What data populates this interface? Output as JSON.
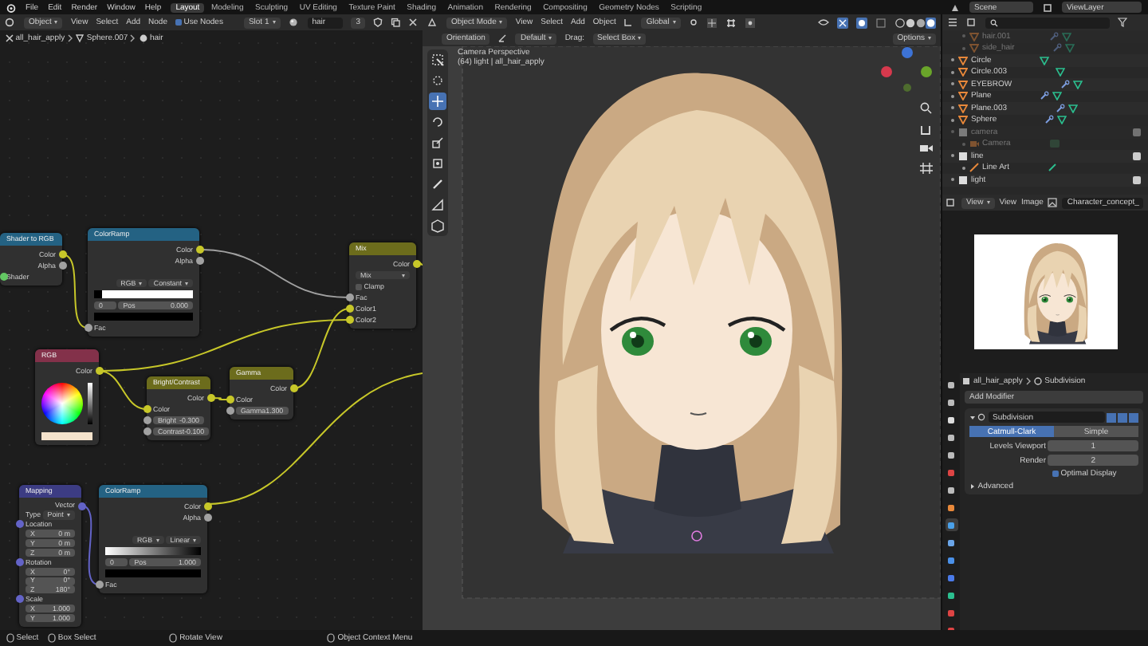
{
  "top_bar": {
    "menus": [
      "File",
      "Edit",
      "Render",
      "Window",
      "Help"
    ],
    "workspaces": [
      {
        "label": "Layout",
        "selected": true
      },
      {
        "label": "Modeling",
        "selected": false
      },
      {
        "label": "Sculpting",
        "selected": false
      },
      {
        "label": "UV Editing",
        "selected": false
      },
      {
        "label": "Texture Paint",
        "selected": false
      },
      {
        "label": "Shading",
        "selected": false
      },
      {
        "label": "Animation",
        "selected": false
      },
      {
        "label": "Rendering",
        "selected": false
      },
      {
        "label": "Compositing",
        "selected": false
      },
      {
        "label": "Geometry Nodes",
        "selected": false
      },
      {
        "label": "Scripting",
        "selected": false
      }
    ],
    "scene": "Scene",
    "view_layer": "ViewLayer"
  },
  "node_editor": {
    "header": {
      "mode": "Object",
      "menus": [
        "View",
        "Select",
        "Add",
        "Node"
      ],
      "use_nodes": {
        "label": "Use Nodes",
        "checked": true
      },
      "slot": "Slot 1",
      "material": "hair",
      "users": "3"
    },
    "breadcrumb": [
      "all_hair_apply",
      "Sphere.007",
      "hair"
    ],
    "nodes": [
      {
        "title": "Shader to RGB",
        "color": "#246283",
        "rows": [
          {
            "kind": "output",
            "label": "Color",
            "color": "#c7c729"
          },
          {
            "kind": "output",
            "label": "Alpha",
            "color": "#a1a1a1"
          },
          {
            "kind": "input",
            "label": "Shader",
            "color": "#63c763"
          }
        ]
      },
      {
        "title": "ColorRamp",
        "color": "#246283",
        "rows": [
          {
            "kind": "output",
            "label": "Color",
            "color": "#c7c729"
          },
          {
            "kind": "output",
            "label": "Alpha",
            "color": "#a1a1a1"
          },
          {
            "kind": "spacer"
          },
          {
            "kind": "select",
            "items": [
              "RGB",
              "Constant"
            ]
          },
          {
            "kind": "step_ramp"
          },
          {
            "kind": "stop",
            "index": "0",
            "label": "Pos",
            "value": "0.000"
          },
          {
            "kind": "swatch",
            "color": "#000000"
          },
          {
            "kind": "input",
            "label": "Fac",
            "color": "#a1a1a1"
          }
        ]
      },
      {
        "title": "Mix",
        "color": "#6c6c1c",
        "rows": [
          {
            "kind": "output",
            "label": "Color",
            "color": "#c7c729"
          },
          {
            "kind": "dropdown",
            "value": "Mix"
          },
          {
            "kind": "checkbox",
            "label": "Clamp",
            "checked": false
          },
          {
            "kind": "input",
            "label": "Fac",
            "color": "#a1a1a1"
          },
          {
            "kind": "input",
            "label": "Color1",
            "color": "#c7c729"
          },
          {
            "kind": "input",
            "label": "Color2",
            "color": "#c7c729"
          }
        ]
      },
      {
        "title": "RGB",
        "color": "#83314a",
        "rows": [
          {
            "kind": "output",
            "label": "Color",
            "color": "#c7c729"
          },
          {
            "kind": "wheel"
          },
          {
            "kind": "swatch",
            "color": "#f5e3cc"
          }
        ]
      },
      {
        "title": "Bright/Contrast",
        "color": "#6c6c1c",
        "rows": [
          {
            "kind": "output",
            "label": "Color",
            "color": "#c7c729"
          },
          {
            "kind": "input",
            "label": "Color",
            "color": "#c7c729"
          },
          {
            "kind": "field",
            "label": "Bright",
            "value": "-0.300",
            "color": "#a1a1a1"
          },
          {
            "kind": "field",
            "label": "Contrast",
            "value": "-0.100",
            "color": "#a1a1a1"
          }
        ]
      },
      {
        "title": "Gamma",
        "color": "#6c6c1c",
        "rows": [
          {
            "kind": "output",
            "label": "Color",
            "color": "#c7c729"
          },
          {
            "kind": "input",
            "label": "Color",
            "color": "#c7c729"
          },
          {
            "kind": "field",
            "label": "Gamma",
            "value": "1.300",
            "color": "#a1a1a1"
          }
        ]
      },
      {
        "title": "Mapping",
        "color": "#3c3c83",
        "rows": [
          {
            "kind": "output",
            "label": "Vector",
            "color": "#6363c7"
          },
          {
            "kind": "dropdown",
            "label": "Type",
            "value": "Point"
          },
          {
            "kind": "heading",
            "label": "Location",
            "color": "#6363c7"
          },
          {
            "kind": "field",
            "label": "X",
            "value": "0 m"
          },
          {
            "kind": "field",
            "label": "Y",
            "value": "0 m"
          },
          {
            "kind": "field",
            "label": "Z",
            "value": "0 m"
          },
          {
            "kind": "heading",
            "label": "Rotation",
            "color": "#6363c7"
          },
          {
            "kind": "field",
            "label": "X",
            "value": "0°"
          },
          {
            "kind": "field",
            "label": "Y",
            "value": "0°"
          },
          {
            "kind": "field",
            "label": "Z",
            "value": "180°"
          },
          {
            "kind": "heading",
            "label": "Scale",
            "color": "#6363c7"
          },
          {
            "kind": "field",
            "label": "X",
            "value": "1.000"
          },
          {
            "kind": "field",
            "label": "Y",
            "value": "1.000"
          }
        ]
      },
      {
        "title": "ColorRamp",
        "color": "#246283",
        "rows": [
          {
            "kind": "output",
            "label": "Color",
            "color": "#c7c729"
          },
          {
            "kind": "output",
            "label": "Alpha",
            "color": "#a1a1a1"
          },
          {
            "kind": "spacer"
          },
          {
            "kind": "select",
            "items": [
              "RGB",
              "Linear"
            ]
          },
          {
            "kind": "smooth_ramp"
          },
          {
            "kind": "stop",
            "index": "0",
            "label": "Pos",
            "value": "1.000"
          },
          {
            "kind": "swatch",
            "color": "#000000"
          },
          {
            "kind": "input",
            "label": "Fac",
            "color": "#a1a1a1"
          }
        ]
      }
    ]
  },
  "viewport": {
    "header": {
      "mode": "Object Mode",
      "menus": [
        "View",
        "Select",
        "Add",
        "Object"
      ],
      "orientation": "Global"
    },
    "tool_settings": {
      "orientation_label": "Orientation",
      "orientation": "Default",
      "drag_label": "Drag:",
      "drag": "Select Box",
      "options": "Options"
    },
    "overlay": {
      "title": "Camera Perspective",
      "subtitle": "(64) light | all_hair_apply"
    },
    "tools": [
      {
        "selected": false
      },
      {
        "selected": false
      },
      {
        "selected": true
      },
      {
        "selected": false
      },
      {
        "selected": false
      },
      {
        "selected": false
      },
      {
        "selected": false
      },
      {
        "selected": false
      },
      {
        "selected": false
      }
    ]
  },
  "outliner": {
    "nested_above": [
      {
        "name": "hair.001",
        "modifiers": true
      },
      {
        "name": "side_hair",
        "modifiers": true
      }
    ],
    "items": [
      {
        "kind": "object",
        "name": "Circle",
        "modifiers": false,
        "disabled": false
      },
      {
        "kind": "object",
        "name": "Circle.003",
        "modifiers": false,
        "disabled": false
      },
      {
        "kind": "object",
        "name": "EYEBROW",
        "modifiers": true,
        "disabled": false
      },
      {
        "kind": "object",
        "name": "Plane",
        "modifiers": true,
        "disabled": false
      },
      {
        "kind": "object",
        "name": "Plane.003",
        "modifiers": true,
        "disabled": false
      },
      {
        "kind": "object",
        "name": "Sphere",
        "modifiers": true,
        "disabled": false
      },
      {
        "kind": "collection",
        "name": "camera",
        "disabled": true,
        "children": [
          {
            "kind": "camera",
            "name": "Camera",
            "disabled": true
          }
        ]
      },
      {
        "kind": "collection",
        "name": "line",
        "disabled": false,
        "children": [
          {
            "kind": "lineart",
            "name": "Line Art",
            "disabled": false
          }
        ]
      },
      {
        "kind": "collection",
        "name": "light",
        "disabled": false
      }
    ]
  },
  "image_editor": {
    "menus": [
      "View",
      "View",
      "Image"
    ],
    "image": "Character_concept_"
  },
  "properties": {
    "tabs": [
      {
        "selected": false
      },
      {
        "selected": false
      },
      {
        "selected": false
      },
      {
        "selected": false
      },
      {
        "selected": false
      },
      {
        "selected": false
      },
      {
        "selected": false
      },
      {
        "selected": false
      },
      {
        "selected": true
      },
      {
        "selected": false
      },
      {
        "selected": false
      },
      {
        "selected": false
      },
      {
        "selected": false
      },
      {
        "selected": false
      },
      {
        "selected": false
      }
    ],
    "breadcrumb": [
      "all_hair_apply",
      "Subdivision"
    ],
    "add_modifier": "Add Modifier",
    "modifier": {
      "name": "Subdivision",
      "modes": [
        {
          "label": "Catmull-Clark",
          "selected": true
        },
        {
          "label": "Simple",
          "selected": false
        }
      ],
      "fields": [
        {
          "label": "Levels Viewport",
          "value": "1"
        },
        {
          "label": "Render",
          "value": "2"
        }
      ],
      "optimal_display": {
        "label": "Optimal Display",
        "checked": true
      },
      "advanced": {
        "label": "Advanced",
        "expanded": false
      }
    }
  },
  "status_bar": [
    "Select",
    "Box Select",
    "Rotate View",
    "Object Context Menu"
  ]
}
